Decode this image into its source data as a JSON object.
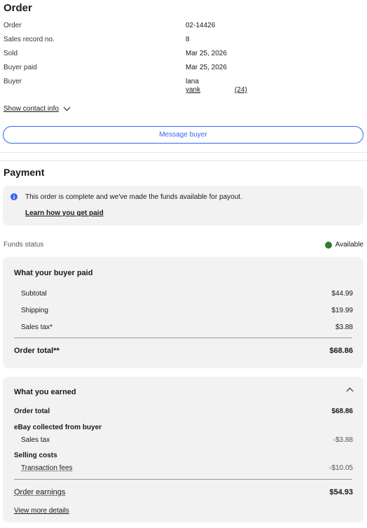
{
  "order": {
    "title": "Order",
    "fields": [
      {
        "label": "Order",
        "value": "02-14426"
      },
      {
        "label": "Sales record no.",
        "value": "8"
      },
      {
        "label": "Sold",
        "value": "Mar 25, 2026"
      },
      {
        "label": "Buyer paid",
        "value": "Mar 25, 2026"
      },
      {
        "label": "Buyer",
        "value": "lana"
      }
    ],
    "buyer_username": "yank",
    "buyer_feedback": "(24)",
    "show_contact_label": "Show contact info",
    "message_button": "Message buyer"
  },
  "payment": {
    "title": "Payment",
    "notice_text": "This order is complete and we've made the funds available for payout.",
    "notice_link": "Learn how you get paid",
    "funds_label": "Funds status",
    "funds_value": "Available",
    "funds_color": "#2e7d32"
  },
  "buyer_paid": {
    "title": "What your buyer paid",
    "rows": [
      {
        "label": "Subtotal",
        "value": "$44.99"
      },
      {
        "label": "Shipping",
        "value": "$19.99"
      },
      {
        "label": "Sales tax*",
        "value": "$3.88"
      }
    ],
    "total_label": "Order total**",
    "total_value": "$68.86"
  },
  "earned": {
    "title": "What you earned",
    "order_total_label": "Order total",
    "order_total_value": "$68.86",
    "collected_label": "eBay collected from buyer",
    "sales_tax_label": "Sales tax",
    "sales_tax_value": "-$3.88",
    "selling_costs_label": "Selling costs",
    "fees_label": "Transaction fees",
    "fees_value": "-$10.05",
    "earnings_label": "Order earnings",
    "earnings_value": "$54.93",
    "view_more": "View more details"
  },
  "colors": {
    "accent": "#3665f3",
    "panel": "#f2f2f2"
  }
}
